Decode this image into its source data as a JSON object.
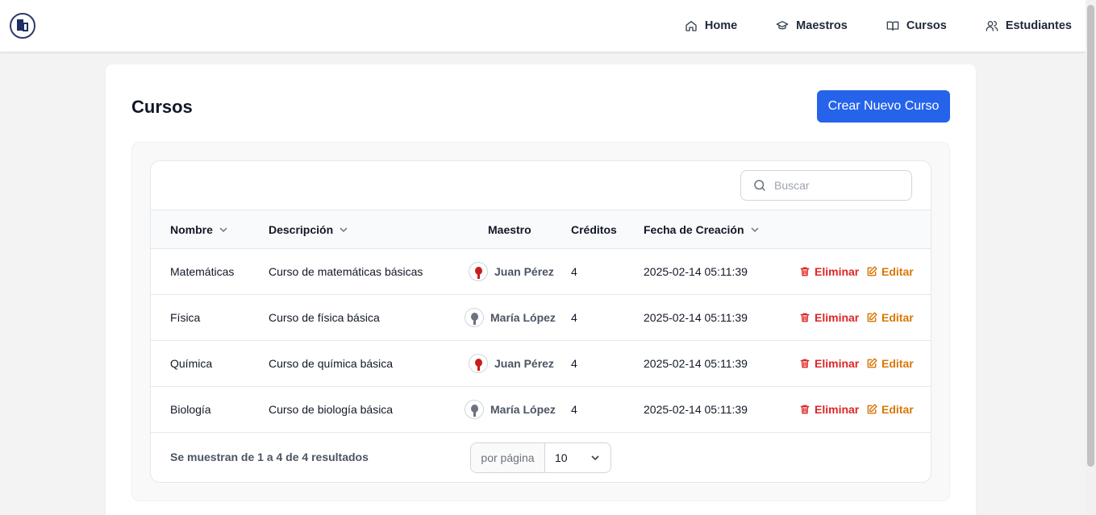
{
  "header": {
    "nav": [
      {
        "label": "Home",
        "icon": "home-icon"
      },
      {
        "label": "Maestros",
        "icon": "graduation-cap-icon"
      },
      {
        "label": "Cursos",
        "icon": "book-icon"
      },
      {
        "label": "Estudiantes",
        "icon": "users-icon"
      }
    ]
  },
  "page": {
    "title": "Cursos",
    "create_button": "Crear Nuevo Curso"
  },
  "search": {
    "placeholder": "Buscar",
    "value": ""
  },
  "table": {
    "columns": [
      {
        "label": "Nombre",
        "sortable": true
      },
      {
        "label": "Descripción",
        "sortable": true
      },
      {
        "label": "Maestro",
        "sortable": false
      },
      {
        "label": "Créditos",
        "sortable": false
      },
      {
        "label": "Fecha de Creación",
        "sortable": true
      }
    ],
    "rows": [
      {
        "name": "Matemáticas",
        "description": "Curso de matemáticas básicas",
        "teacher": "Juan Pérez",
        "credits": "4",
        "created": "2025-02-14 05:11:39",
        "delete": "Eliminar",
        "edit": "Editar"
      },
      {
        "name": "Física",
        "description": "Curso de física básica",
        "teacher": "María López",
        "credits": "4",
        "created": "2025-02-14 05:11:39",
        "delete": "Eliminar",
        "edit": "Editar"
      },
      {
        "name": "Química",
        "description": "Curso de química básica",
        "teacher": "Juan Pérez",
        "credits": "4",
        "created": "2025-02-14 05:11:39",
        "delete": "Eliminar",
        "edit": "Editar"
      },
      {
        "name": "Biología",
        "description": "Curso de biología básica",
        "teacher": "María López",
        "credits": "4",
        "created": "2025-02-14 05:11:39",
        "delete": "Eliminar",
        "edit": "Editar"
      }
    ]
  },
  "footer": {
    "summary": "Se muestran de 1 a 4 de 4 resultados",
    "per_page_label": "por página",
    "per_page_value": "10"
  },
  "colors": {
    "primary": "#2563eb",
    "danger": "#dc2626",
    "warning": "#d97706"
  }
}
